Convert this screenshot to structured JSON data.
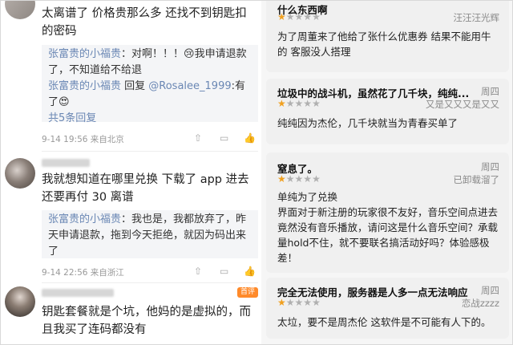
{
  "left": {
    "p1": {
      "text": "太离谱了 价格贵那么多 还找不到钥匙扣的密码",
      "replies": [
        {
          "user": "张富贵的小福贵",
          "text": "：对啊！！！😢我申请退款了，不知道给不给退"
        },
        {
          "user": "张富贵的小福贵",
          "mid": " 回复 ",
          "to": "@Rosalee_1999",
          "text": ":有了😍"
        }
      ],
      "more": "共5条回复",
      "time": "9-14 19:56 来自北京"
    },
    "p2": {
      "text": "我就想知道在哪里兑换 下载了 app 进去还要再付 30 离谱",
      "replies": [
        {
          "user": "张富贵的小福贵",
          "text": "：我也是，我都放弃了，昨天申请退款，拖到今天拒绝，就因为码出来了"
        }
      ],
      "time": "9-14 22:56 来自浙江"
    },
    "p3": {
      "badge": "首评",
      "text": "钥匙套餐就是个坑，他妈的是虚拟的，而且我买了连码都没有"
    },
    "actions": {
      "share": "⇧",
      "comment": "▭",
      "like": "👍"
    }
  },
  "right": {
    "reviews": [
      {
        "title": "什么东西啊",
        "day": "",
        "rating": 1,
        "user": "汪汪汪光辉",
        "body": "为了周董来了他给了张什么优惠券 结果不能用牛的 客服没人搭理"
      },
      {
        "title": "垃圾中的战斗机，虽然花了几千块，纯纯...",
        "day": "周四",
        "rating": 1,
        "user": "又是又又又是又又",
        "body": "纯纯因为杰伦，几千块就当为青春买单了"
      },
      {
        "title": "窒息了。",
        "day": "周四",
        "rating": 1,
        "user": "已卸载溜了",
        "body": "单纯为了兑换\n界面对于新注册的玩家很不友好，音乐空间点进去竟然没有音乐播放，请问这是什么音乐空间？承载量hold不住，就不要联名搞活动好吗？体验感极差！"
      },
      {
        "title": "完全无法使用，服务器是人多一点无法响应",
        "day": "周四",
        "rating": 1,
        "user": "恋战zzzz",
        "body": "太垃，要不是周杰伦 这软件是不可能有人下的。"
      }
    ],
    "star": "★",
    "max_stars": 5
  }
}
